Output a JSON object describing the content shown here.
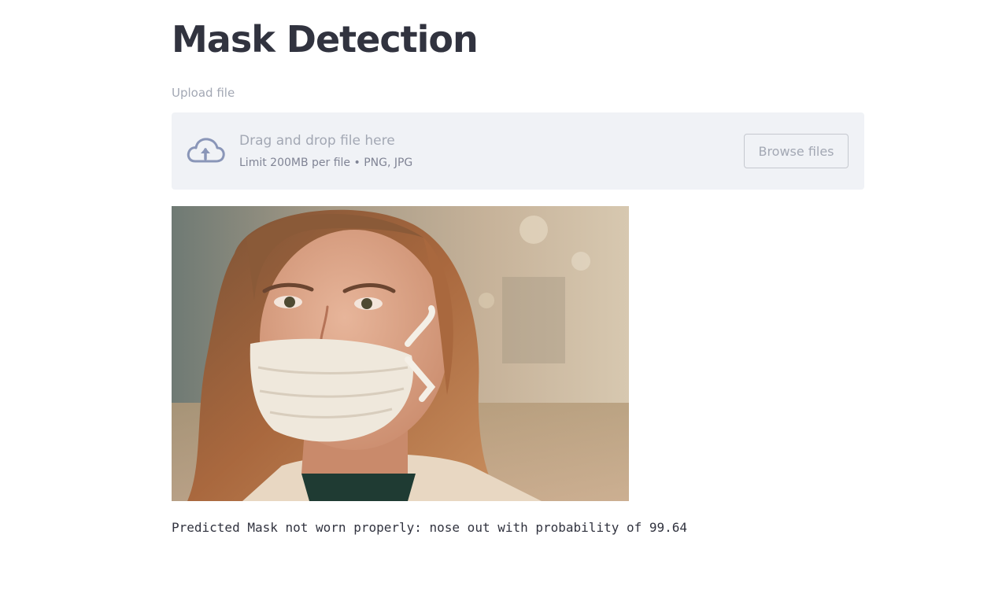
{
  "page": {
    "title": "Mask Detection"
  },
  "uploader": {
    "label": "Upload file",
    "dropzone_primary": "Drag and drop file here",
    "dropzone_secondary": "Limit 200MB per file • PNG, JPG",
    "browse_label": "Browse files",
    "icon": "cloud-upload-icon"
  },
  "image": {
    "description_icon": "uploaded-photo"
  },
  "result": {
    "text": "Predicted Mask not worn properly: nose out with probability of 99.64"
  },
  "colors": {
    "title": "#31333f",
    "muted_text": "#a3a8b4",
    "dropzone_bg": "#f0f2f6",
    "icon": "#8a96b8"
  }
}
